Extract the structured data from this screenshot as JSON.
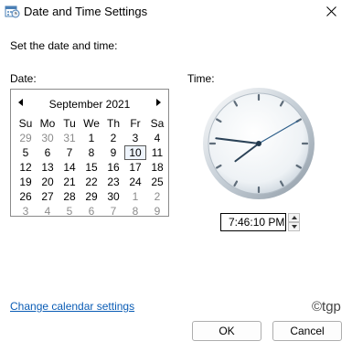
{
  "window": {
    "title": "Date and Time Settings"
  },
  "instruction": "Set the date and time:",
  "date_label": "Date:",
  "time_label": "Time:",
  "calendar": {
    "month_year": "September 2021",
    "weekday_headers": [
      "Su",
      "Mo",
      "Tu",
      "We",
      "Th",
      "Fr",
      "Sa"
    ],
    "weeks": [
      [
        "29",
        "30",
        "31",
        "1",
        "2",
        "3",
        "4"
      ],
      [
        "5",
        "6",
        "7",
        "8",
        "9",
        "10",
        "11"
      ],
      [
        "12",
        "13",
        "14",
        "15",
        "16",
        "17",
        "18"
      ],
      [
        "19",
        "20",
        "21",
        "22",
        "23",
        "24",
        "25"
      ],
      [
        "26",
        "27",
        "28",
        "29",
        "30",
        "1",
        "2"
      ],
      [
        "3",
        "4",
        "5",
        "6",
        "7",
        "8",
        "9"
      ]
    ],
    "selected_day": "10"
  },
  "clock": {
    "hour": 7,
    "minute": 46,
    "second": 10
  },
  "time_value": "7:46:10 PM",
  "change_calendar_link": "Change calendar settings",
  "watermark": "©tgp",
  "buttons": {
    "ok": "OK",
    "cancel": "Cancel"
  },
  "icons": {
    "window": "calendar-clock-icon",
    "close": "close-icon",
    "prev": "left-arrow-icon",
    "next": "right-arrow-icon",
    "spin_up": "up-arrow-icon",
    "spin_down": "down-arrow-icon"
  },
  "colors": {
    "link": "#0a5cb5",
    "clock_face": "#dde4ea",
    "second_hand": "#2e5f8a"
  }
}
